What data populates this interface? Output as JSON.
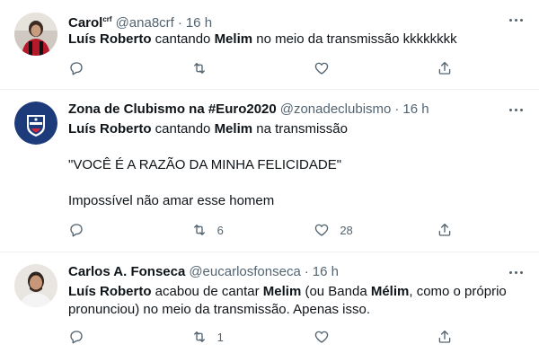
{
  "tweets": [
    {
      "name": "Carol",
      "name_sup": "crf",
      "handle": "@ana8crf",
      "separator": "·",
      "time": "16 h",
      "text": [
        {
          "b": "Luís Roberto"
        },
        {
          "t": " cantando "
        },
        {
          "b": "Melim"
        },
        {
          "t": " no meio da transmissão kkkkkkkk"
        }
      ],
      "paragraphs": [],
      "counts": {
        "reply": "",
        "retweet": "",
        "like": ""
      }
    },
    {
      "name": "Zona de Clubismo na #Euro2020",
      "handle": "@zonadeclubismo",
      "separator": "·",
      "time": "16 h",
      "text": [
        {
          "b": "Luís Roberto"
        },
        {
          "t": " cantando "
        },
        {
          "b": "Melim"
        },
        {
          "t": " na transmissão"
        }
      ],
      "paragraphs": [
        "\"VOCÊ É A RAZÃO DA MINHA FELICIDADE\"",
        "Impossível não amar esse homem"
      ],
      "counts": {
        "reply": "",
        "retweet": "6",
        "like": "28"
      }
    },
    {
      "name": "Carlos A. Fonseca",
      "handle": "@eucarlosfonseca",
      "separator": "·",
      "time": "16 h",
      "text": [
        {
          "b": "Luís Roberto"
        },
        {
          "t": " acabou de cantar "
        },
        {
          "b": "Melim"
        },
        {
          "t": " (ou Banda "
        },
        {
          "b": "Mélim"
        },
        {
          "t": ", como o próprio pronunciou) no meio da transmissão. Apenas isso."
        }
      ],
      "paragraphs": [],
      "counts": {
        "reply": "",
        "retweet": "1",
        "like": ""
      }
    }
  ],
  "icons": {
    "reply": "reply-icon",
    "retweet": "retweet-icon",
    "like": "heart-icon",
    "share": "share-icon",
    "more": "more-icon"
  },
  "colors": {
    "text": "#0f1419",
    "secondary": "#536471",
    "divider": "#eff3f4",
    "zona_avatar_bg": "#1d3a7a",
    "zona_avatar_accent": "#d7263d"
  }
}
